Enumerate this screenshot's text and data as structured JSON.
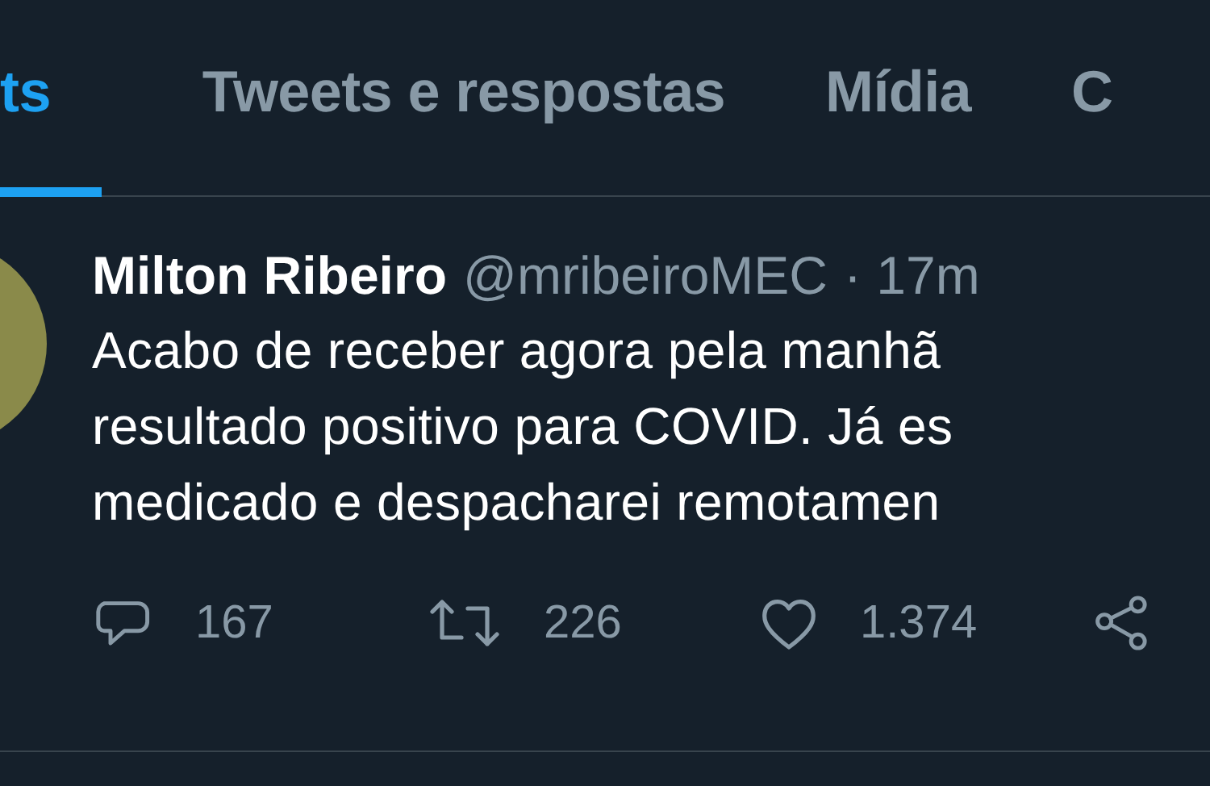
{
  "tabs": [
    {
      "label": "ts",
      "selected": true
    },
    {
      "label": "Tweets e respostas",
      "selected": false
    },
    {
      "label": "Mídia",
      "selected": false
    },
    {
      "label": "C",
      "selected": false
    }
  ],
  "tweet": {
    "author": "Milton Ribeiro",
    "handle": "@mribeiroMEC",
    "time": "· 17m",
    "text_lines": [
      "Acabo de receber agora pela manhã",
      "resultado positivo para COVID. Já es",
      "medicado e despacharei remotamen"
    ],
    "actions": [
      {
        "kind": "reply",
        "count": "167"
      },
      {
        "kind": "retweet",
        "count": "226"
      },
      {
        "kind": "like",
        "count": "1.374"
      },
      {
        "kind": "share"
      }
    ]
  }
}
